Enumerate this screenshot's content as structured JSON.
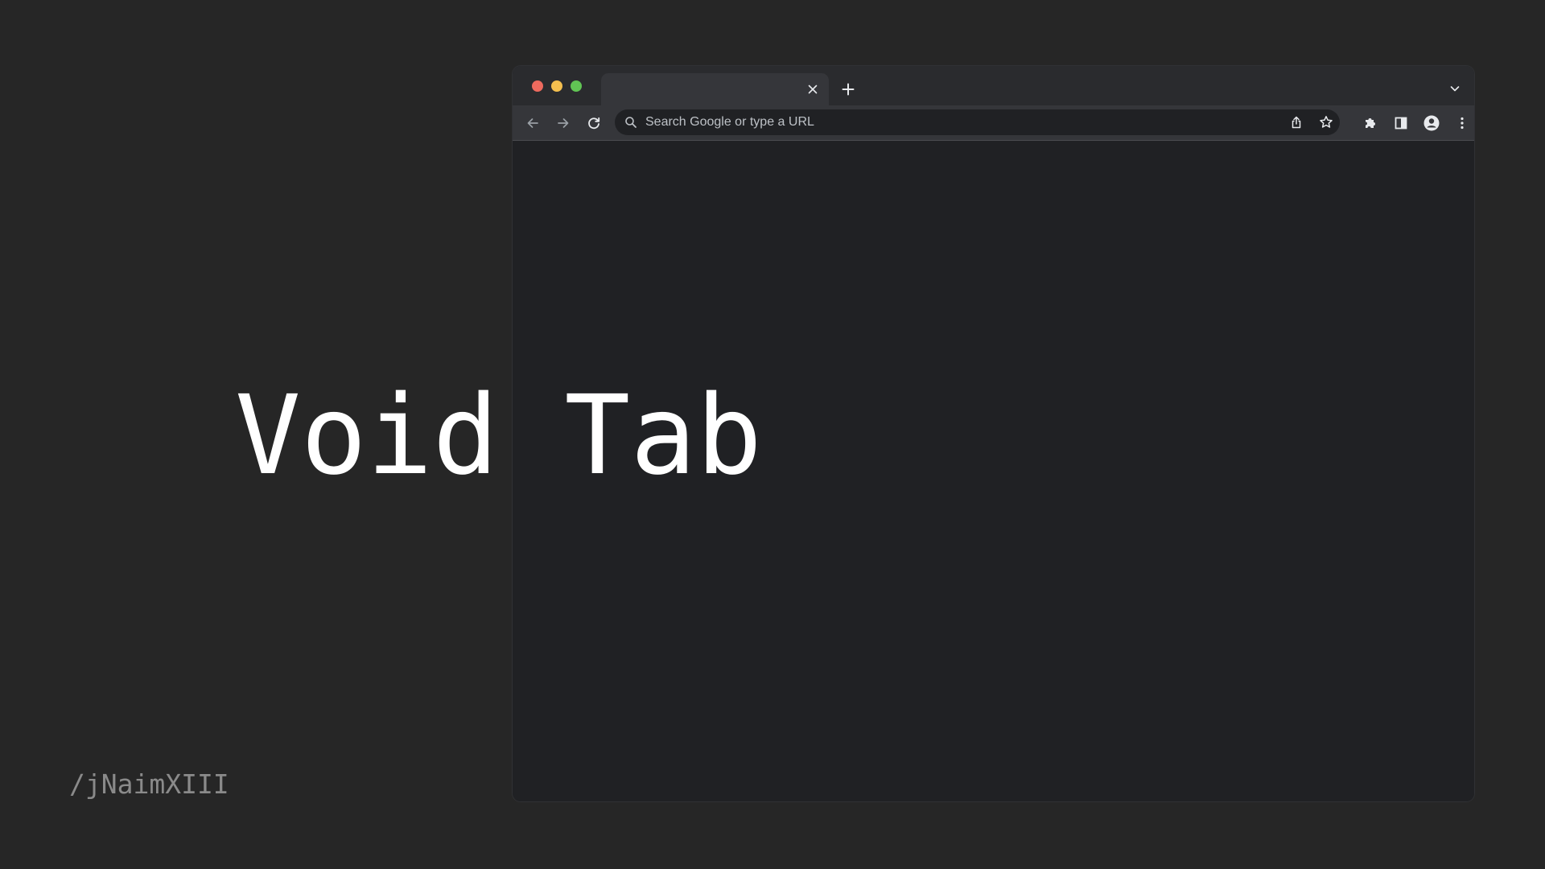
{
  "browser": {
    "tab": {
      "title": ""
    },
    "omnibox": {
      "placeholder": "Search Google or type a URL",
      "value": ""
    },
    "icons": {
      "traffic_lights": [
        "close-dot",
        "minimize-dot",
        "zoom-dot"
      ],
      "toolbar": [
        "back-arrow-icon",
        "forward-arrow-icon",
        "reload-icon",
        "search-icon",
        "share-icon",
        "star-icon",
        "extensions-puzzle-icon",
        "side-panel-icon",
        "profile-icon",
        "more-vert-icon"
      ]
    }
  },
  "overlay": {
    "headline": "Void Tab",
    "handle": "/jNaimXIII"
  },
  "colors": {
    "background": "#262626",
    "window_content": "#202124",
    "toolbar": "#35363a",
    "tabstrip": "#2a2b2e",
    "light_red": "#ed6a5e",
    "light_yellow": "#f4bf4f",
    "light_green": "#61c554"
  }
}
